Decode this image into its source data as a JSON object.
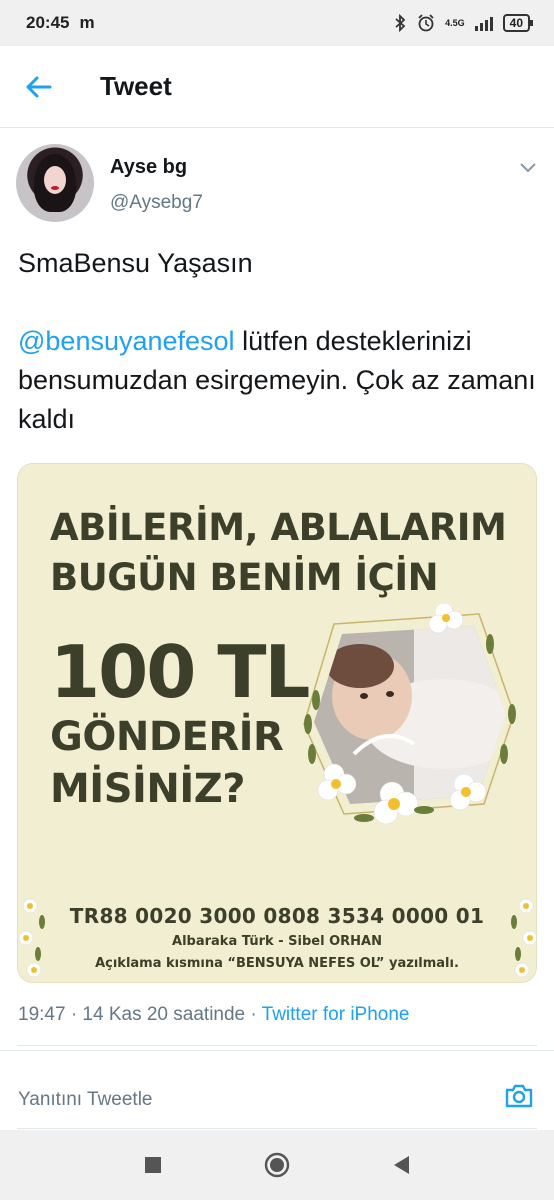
{
  "status_bar": {
    "time": "20:45",
    "carrier_mark": "m",
    "network": "4.5G",
    "battery": "40",
    "icons": [
      "bluetooth-icon",
      "alarm-icon",
      "signal-icon",
      "battery-icon"
    ]
  },
  "header": {
    "title": "Tweet",
    "back_icon": "arrow-left-icon"
  },
  "tweet": {
    "author_name": "Ayse bg",
    "author_handle": "@Aysebg7",
    "text_line1": "SmaBensu Yaşasın",
    "mention": "@bensuyanefesol",
    "text_after_mention": " lütfen desteklerinizi bensumuzdan esirgemeyin. Çok az zamanı kaldı",
    "media": {
      "line1": "ABİLERİM, ABLALARIM",
      "line2": "BUGÜN BENİM İÇİN",
      "amount": "100 TL",
      "line3": "GÖNDERİR",
      "line4": "MİSİNİZ?",
      "iban": "TR88 0020 3000 0808 3534 0000 01",
      "bank": "Albaraka Türk - Sibel ORHAN",
      "note": "Açıklama kısmına “BENSUYA NEFES OL” yazılmalı."
    },
    "timestamp": "19:47 · 14 Kas 20 saatinde · ",
    "source_app": "Twitter for iPhone"
  },
  "reply": {
    "placeholder": "Yanıtını Tweetle",
    "camera_icon": "camera-icon"
  },
  "nav": {
    "icons": [
      "recent-apps-icon",
      "home-icon",
      "back-icon"
    ]
  },
  "colors": {
    "accent": "#1da1f2",
    "secondary_text": "#657786",
    "media_bg": "#f1eed2",
    "media_text": "#3c3f29"
  }
}
